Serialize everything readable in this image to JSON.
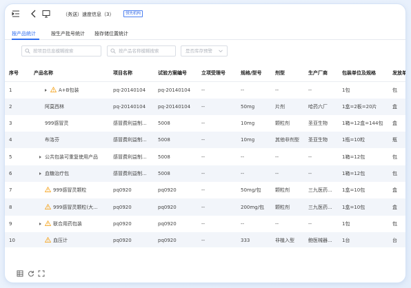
{
  "title": {
    "text": "（务送）速度信息（3）",
    "badge": "领先机构"
  },
  "tabs": [
    {
      "label": "按产品统计",
      "active": true
    },
    {
      "label": "按生产批号统计",
      "active": false
    },
    {
      "label": "按存储位置统计",
      "active": false
    }
  ],
  "filters": {
    "search1_placeholder": "按项目信息模糊搜索",
    "search2_placeholder": "按产品名称模糊搜索",
    "select_placeholder": "是否库存预警"
  },
  "table": {
    "columns": [
      "序号",
      "产品名称",
      "项目名称",
      "试验方案编号",
      "立项受理号",
      "规格/型号",
      "剂型",
      "生产厂商",
      "包装单位及规格",
      "发放单"
    ],
    "rows": [
      {
        "no": "1",
        "name": "A+B包装",
        "expand": true,
        "warn": true,
        "indent": 1,
        "project": "pq-20140104",
        "scheme": "pq-20140104",
        "accept": "--",
        "spec": "--",
        "form": "--",
        "maker": "--",
        "pack": "1包",
        "issue": "包"
      },
      {
        "no": "2",
        "name": "阿莫西林",
        "expand": false,
        "warn": false,
        "indent": 1,
        "project": "pq-20140104",
        "scheme": "pq-20140104",
        "accept": "--",
        "spec": "50mg",
        "form": "片剂",
        "maker": "哈药六厂",
        "pack": "1盒=2板=20片",
        "issue": "盒"
      },
      {
        "no": "3",
        "name": "999感冒灵",
        "expand": false,
        "warn": false,
        "indent": 1,
        "project": "感冒费利益制...",
        "scheme": "5008",
        "accept": "--",
        "spec": "10mg",
        "form": "颗粒剂",
        "maker": "圣亚生物",
        "pack": "1箱=12盒=144包",
        "issue": "盒"
      },
      {
        "no": "4",
        "name": "布洛芬",
        "expand": false,
        "warn": false,
        "indent": 1,
        "project": "感冒费利益制...",
        "scheme": "5008",
        "accept": "--",
        "spec": "10mg",
        "form": "其他非剂型",
        "maker": "圣亚生物",
        "pack": "1瓶=10粒",
        "issue": "瓶"
      },
      {
        "no": "5",
        "name": "公共包装可重复使用产品",
        "expand": true,
        "warn": false,
        "indent": 0,
        "project": "感冒费利益制...",
        "scheme": "5008",
        "accept": "--",
        "spec": "--",
        "form": "--",
        "maker": "--",
        "pack": "1箱=12包",
        "issue": "包"
      },
      {
        "no": "6",
        "name": "血糖治疗包",
        "expand": true,
        "warn": false,
        "indent": 0,
        "project": "感冒费利益制...",
        "scheme": "5008",
        "accept": "--",
        "spec": "--",
        "form": "--",
        "maker": "--",
        "pack": "1箱=12包",
        "issue": "包"
      },
      {
        "no": "7",
        "name": "999感冒灵颗粒",
        "expand": false,
        "warn": true,
        "indent": 1,
        "project": "pq0920",
        "scheme": "pq0920",
        "accept": "--",
        "spec": "50mg/包",
        "form": "颗粒剂",
        "maker": "三九医药...",
        "pack": "1盒=10包",
        "issue": "盒"
      },
      {
        "no": "8",
        "name": "999感冒灵颗粒(大...",
        "expand": false,
        "warn": true,
        "indent": 1,
        "project": "pq0920",
        "scheme": "pq0920",
        "accept": "--",
        "spec": "200mg/包",
        "form": "颗粒剂",
        "maker": "三九医药...",
        "pack": "1盒=10包",
        "issue": "盒"
      },
      {
        "no": "9",
        "name": "联合用药包装",
        "expand": true,
        "warn": true,
        "indent": 0,
        "project": "pq0920",
        "scheme": "pq0920",
        "accept": "--",
        "spec": "--",
        "form": "--",
        "maker": "--",
        "pack": "1包",
        "issue": "包"
      },
      {
        "no": "10",
        "name": "血压计",
        "expand": false,
        "warn": true,
        "indent": 1,
        "project": "pq0920",
        "scheme": "pq0920",
        "accept": "--",
        "spec": "333",
        "form": "非植入型",
        "maker": "鲍医械器...",
        "pack": "1台",
        "issue": "台"
      }
    ]
  },
  "icons": {
    "titlebar": [
      "list-indent-icon",
      "back-arrow-icon",
      "monitor-icon"
    ],
    "footer": [
      "table-settings-icon",
      "refresh-icon",
      "fullscreen-icon"
    ]
  },
  "colors": {
    "accent": "#2d6cf0",
    "warn": "#f5a623",
    "stripe": "#f2f5fa"
  }
}
